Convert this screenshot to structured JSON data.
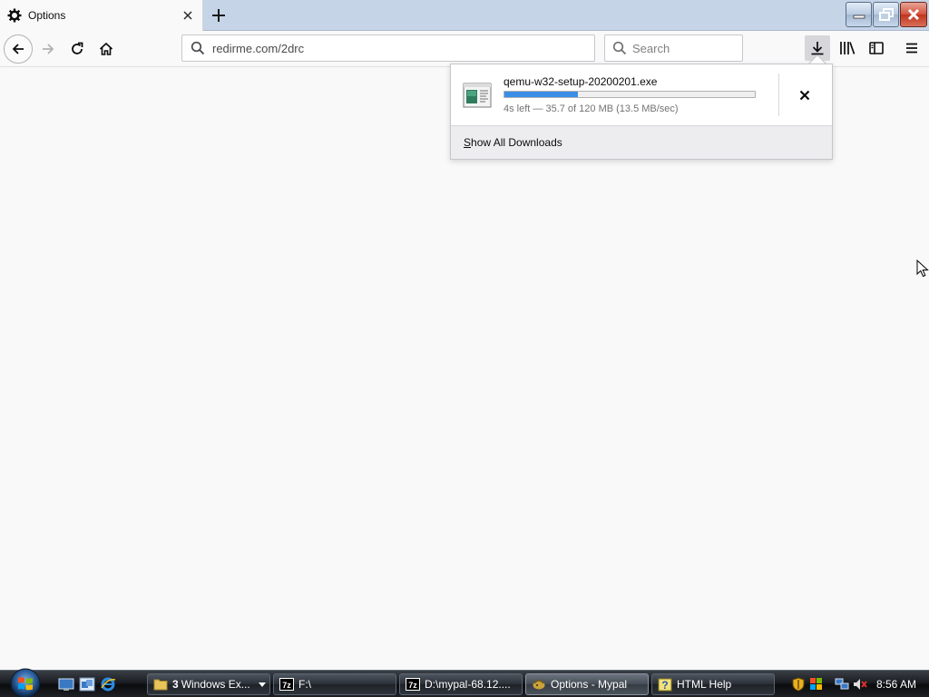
{
  "browser": {
    "tab": {
      "title": "Options",
      "icon": "gear-icon"
    },
    "urlbar": {
      "value": "redirme.com/2drc"
    },
    "search": {
      "placeholder": "Search"
    }
  },
  "downloads_panel": {
    "item": {
      "filename": "qemu-w32-setup-20200201.exe",
      "progress_fraction": 0.295,
      "status": "4s left — 35.7 of 120 MB (13.5 MB/sec)"
    },
    "footer_label": "Show All Downloads"
  },
  "taskbar": {
    "tasks": [
      {
        "count": "3",
        "label": "Windows Ex...",
        "icon": "folder-icon"
      },
      {
        "label": "F:\\",
        "icon": "7zip-icon"
      },
      {
        "label": "D:\\mypal-68.12....",
        "icon": "7zip-icon"
      },
      {
        "label": "Options - Mypal",
        "icon": "mypal-icon"
      },
      {
        "label": "HTML Help",
        "icon": "help-icon"
      }
    ],
    "clock": "8:56 AM"
  }
}
